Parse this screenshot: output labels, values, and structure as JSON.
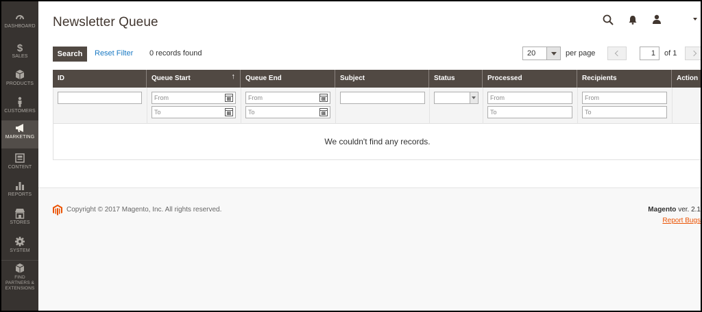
{
  "sidebar": {
    "items": [
      {
        "label": "DASHBOARD",
        "icon": "dashboard-icon"
      },
      {
        "label": "SALES",
        "icon": "dollar-icon"
      },
      {
        "label": "PRODUCTS",
        "icon": "cube-icon"
      },
      {
        "label": "CUSTOMERS",
        "icon": "person-icon"
      },
      {
        "label": "MARKETING",
        "icon": "megaphone-icon"
      },
      {
        "label": "CONTENT",
        "icon": "content-icon"
      },
      {
        "label": "REPORTS",
        "icon": "bar-chart-icon"
      },
      {
        "label": "STORES",
        "icon": "store-icon"
      },
      {
        "label": "SYSTEM",
        "icon": "gear-icon"
      },
      {
        "label": "FIND PARTNERS & EXTENSIONS",
        "icon": "box-icon"
      }
    ],
    "active": "MARKETING"
  },
  "header": {
    "title": "Newsletter Queue"
  },
  "toolbar": {
    "search_label": "Search",
    "reset_label": "Reset Filter",
    "records_found": "0 records found",
    "per_page_value": "20",
    "per_page_label": "per page",
    "page_value": "1",
    "page_of": "of 1"
  },
  "grid": {
    "columns": [
      "ID",
      "Queue Start",
      "Queue End",
      "Subject",
      "Status",
      "Processed",
      "Recipients",
      "Action"
    ],
    "sort_indicator": "↑",
    "filters": {
      "from_placeholder": "From",
      "to_placeholder": "To"
    },
    "empty_message": "We couldn't find any records."
  },
  "footer": {
    "copyright": "Copyright © 2017 Magento, Inc. All rights reserved.",
    "brand": "Magento",
    "version": "ver. 2.1",
    "report_bugs": "Report Bugs"
  },
  "colors": {
    "sidebar_bg": "#373330",
    "sidebar_active": "#524d49",
    "header_bar": "#514943",
    "link": "#1979c3",
    "accent": "#eb5202"
  }
}
